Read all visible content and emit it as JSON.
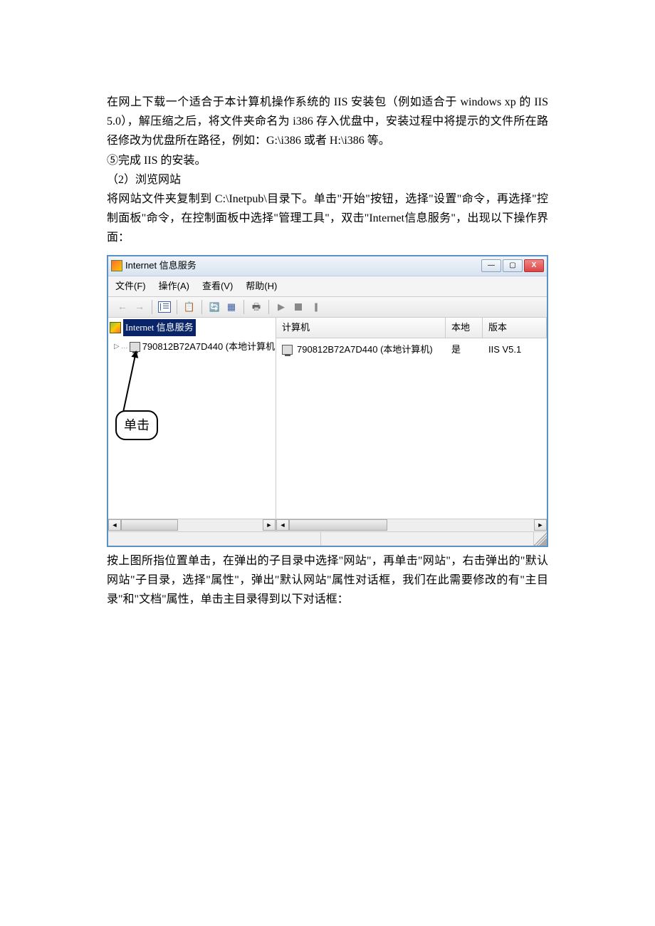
{
  "doc": {
    "p1": "在网上下载一个适合于本计算机操作系统的 IIS 安装包（例如适合于 windows xp 的 IIS  5.0），解压缩之后，将文件夹命名为 i386 存入优盘中，安装过程中将提示的文件所在路径修改为优盘所在路径，例如：G:\\i386 或者 H:\\i386 等。",
    "p2": "⑤完成 IIS 的安装。",
    "p3": "（2）浏览网站",
    "p4": "将网站文件夹复制到 C:\\Inetpub\\目录下。单击\"开始\"按钮，选择\"设置\"命令，再选择\"控制面板\"命令，在控制面板中选择\"管理工具\"，双击\"Internet信息服务\"，出现以下操作界面：",
    "p5": "按上图所指位置单击，在弹出的子目录中选择\"网站\"，再单击\"网站\"，右击弹出的\"默认网站\"子目录，选择\"属性\"，弹出\"默认网站\"属性对话框，我们在此需要修改的有\"主目录\"和\"文档\"属性，单击主目录得到以下对话框："
  },
  "window": {
    "title": "Internet 信息服务",
    "menu": {
      "file": "文件(F)",
      "action": "操作(A)",
      "view": "查看(V)",
      "help": "帮助(H)"
    },
    "tree": {
      "root": "Internet 信息服务",
      "node1": "790812B72A7D440 (本地计算机"
    },
    "annotation": "单击",
    "columns": {
      "computer": "计算机",
      "local": "本地",
      "version": "版本"
    },
    "row1": {
      "computer": "790812B72A7D440 (本地计算机)",
      "local": "是",
      "version": "IIS V5.1"
    }
  }
}
